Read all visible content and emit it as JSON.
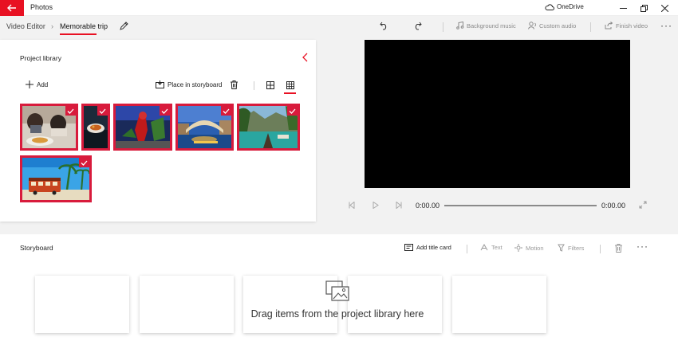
{
  "titlebar": {
    "app_name": "Photos",
    "onedrive": "OneDrive"
  },
  "breadcrumb": {
    "parent": "Video Editor",
    "current": "Memorable trip"
  },
  "toolbar": {
    "background_music": "Background music",
    "custom_audio": "Custom audio",
    "finish_video": "Finish video"
  },
  "library": {
    "title": "Project library",
    "add": "Add",
    "place_in_storyboard": "Place in storyboard",
    "items": [
      {
        "name": "food-photo",
        "selected": true
      },
      {
        "name": "dish-photo",
        "selected": true
      },
      {
        "name": "person-photo",
        "selected": true
      },
      {
        "name": "bridge-photo",
        "selected": true
      },
      {
        "name": "boat-photo",
        "selected": true
      },
      {
        "name": "tram-photo",
        "selected": true
      }
    ]
  },
  "player": {
    "current_time": "0:00.00",
    "total_time": "0:00.00"
  },
  "storyboard": {
    "title": "Storyboard",
    "add_title_card": "Add title card",
    "text": "Text",
    "motion": "Motion",
    "filters": "Filters",
    "drop_hint": "Drag items from the project library here"
  },
  "colors": {
    "accent": "#e81123",
    "selection": "#d81b3c"
  }
}
